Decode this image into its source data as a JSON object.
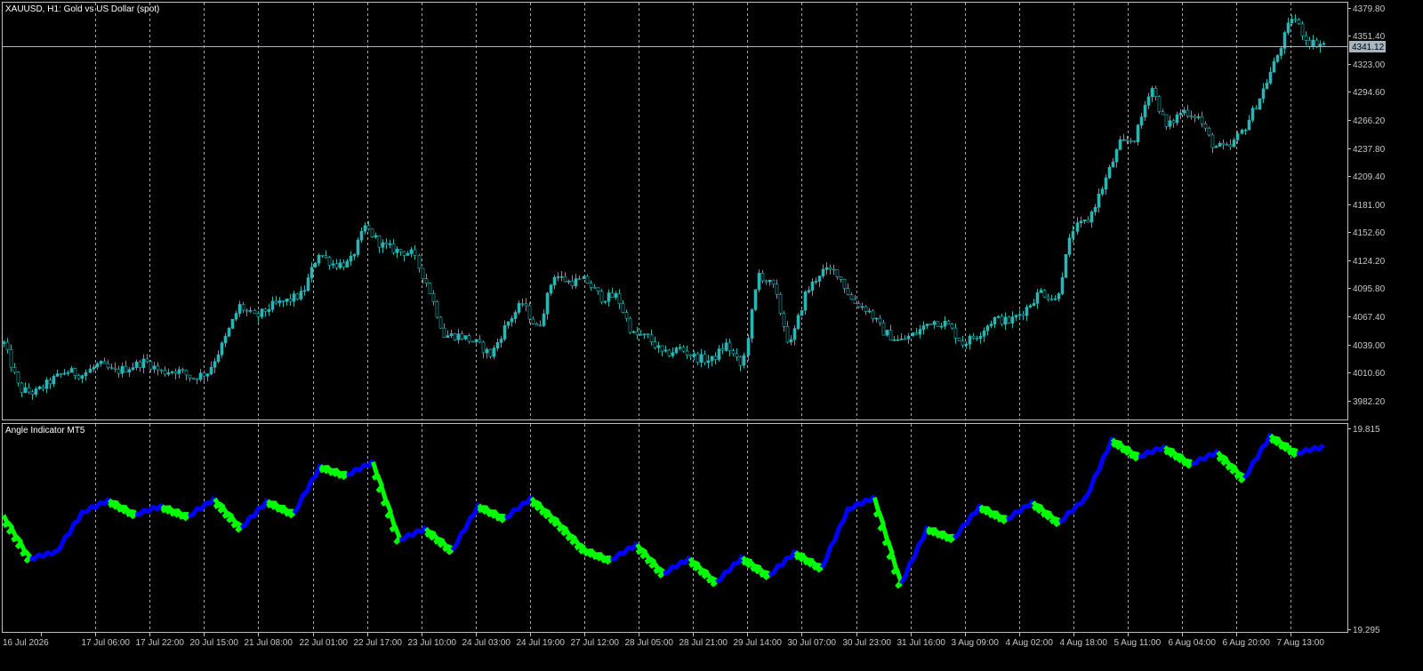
{
  "main_pane": {
    "title": "XAUUSD, H1:  Gold vs US Dollar (spot)",
    "current_price": "4341.12",
    "price_labels": [
      "4379.80",
      "4351.40",
      "4323.00",
      "4294.60",
      "4266.20",
      "4237.80",
      "4209.40",
      "4181.00",
      "4152.60",
      "4124.20",
      "4095.80",
      "4067.40",
      "4039.00",
      "4010.60",
      "3982.20"
    ]
  },
  "indicator_pane": {
    "title": "Angle Indicator MT5",
    "top_label": "19.815",
    "bottom_label": "19.295"
  },
  "time_axis": {
    "labels": [
      "16 Jul 2026",
      "17 Jul 06:00",
      "17 Jul 22:00",
      "20 Jul 15:00",
      "21 Jul 08:00",
      "22 Jul 01:00",
      "22 Jul 17:00",
      "23 Jul 10:00",
      "24 Jul 03:00",
      "24 Jul 19:00",
      "27 Jul 12:00",
      "28 Jul 05:00",
      "28 Jul 21:00",
      "29 Jul 14:00",
      "30 Jul 07:00",
      "30 Jul 23:00",
      "31 Jul 16:00",
      "3 Aug 09:00",
      "4 Aug 02:00",
      "4 Aug 18:00",
      "5 Aug 11:00",
      "6 Aug 04:00",
      "6 Aug 20:00",
      "7 Aug 13:00"
    ]
  },
  "colors": {
    "background": "#000000",
    "candles": "#2bb5b5",
    "grid": "#c0c0c0",
    "indicator_up": "#0000ff",
    "indicator_down": "#00ff00",
    "price_line": "#a7b6c0"
  },
  "chart_data": [
    {
      "type": "candlestick",
      "title": "XAUUSD, H1:  Gold vs US Dollar (spot)",
      "timeframe": "H1",
      "ylim": [
        3963,
        4385
      ],
      "current_price": 4341.12,
      "x": [
        "16 Jul 2026",
        "17 Jul 06:00",
        "17 Jul 22:00",
        "20 Jul 15:00",
        "21 Jul 08:00",
        "22 Jul 01:00",
        "22 Jul 17:00",
        "23 Jul 10:00",
        "24 Jul 03:00",
        "24 Jul 19:00",
        "27 Jul 12:00",
        "28 Jul 05:00",
        "28 Jul 21:00",
        "29 Jul 14:00",
        "30 Jul 07:00",
        "30 Jul 23:00",
        "31 Jul 16:00",
        "3 Aug 09:00",
        "4 Aug 02:00",
        "4 Aug 18:00",
        "5 Aug 11:00",
        "6 Aug 04:00",
        "6 Aug 20:00",
        "7 Aug 13:00"
      ],
      "close_path": [
        4040,
        3993,
        3990,
        4002,
        4012,
        4008,
        4019,
        4011,
        4016,
        4022,
        4011,
        4013,
        4005,
        4011,
        4041,
        4078,
        4066,
        4078,
        4083,
        4090,
        4132,
        4120,
        4121,
        4158,
        4140,
        4134,
        4131,
        4097,
        4048,
        4048,
        4041,
        4028,
        4060,
        4081,
        4053,
        4110,
        4102,
        4104,
        4086,
        4088,
        4049,
        4046,
        4028,
        4035,
        4026,
        4022,
        4039,
        4015,
        4111,
        4096,
        4036,
        4090,
        4113,
        4113,
        4083,
        4074,
        4052,
        4042,
        4050,
        4063,
        4060,
        4040,
        4049,
        4065,
        4062,
        4074,
        4093,
        4083,
        4155,
        4165,
        4202,
        4242,
        4248,
        4302,
        4258,
        4276,
        4270,
        4240,
        4237,
        4260,
        4292,
        4330,
        4372,
        4345,
        4343
      ]
    },
    {
      "type": "line",
      "title": "Angle Indicator MT5",
      "ylim": [
        19.295,
        19.815
      ],
      "series": [
        {
          "values": [
            19.587,
            19.479,
            19.495,
            19.595,
            19.625,
            19.59,
            19.61,
            19.585,
            19.628,
            19.556,
            19.623,
            19.592,
            19.71,
            19.688,
            19.72,
            19.526,
            19.554,
            19.5,
            19.612,
            19.58,
            19.63,
            19.57,
            19.502,
            19.476,
            19.514,
            19.442,
            19.479,
            19.42,
            19.482,
            19.437,
            19.495,
            19.456,
            19.603,
            19.631,
            19.416,
            19.555,
            19.53,
            19.61,
            19.577,
            19.62,
            19.57,
            19.63,
            19.777,
            19.734,
            19.758,
            19.716,
            19.745,
            19.68,
            19.787,
            19.743,
            19.758
          ]
        }
      ]
    }
  ]
}
